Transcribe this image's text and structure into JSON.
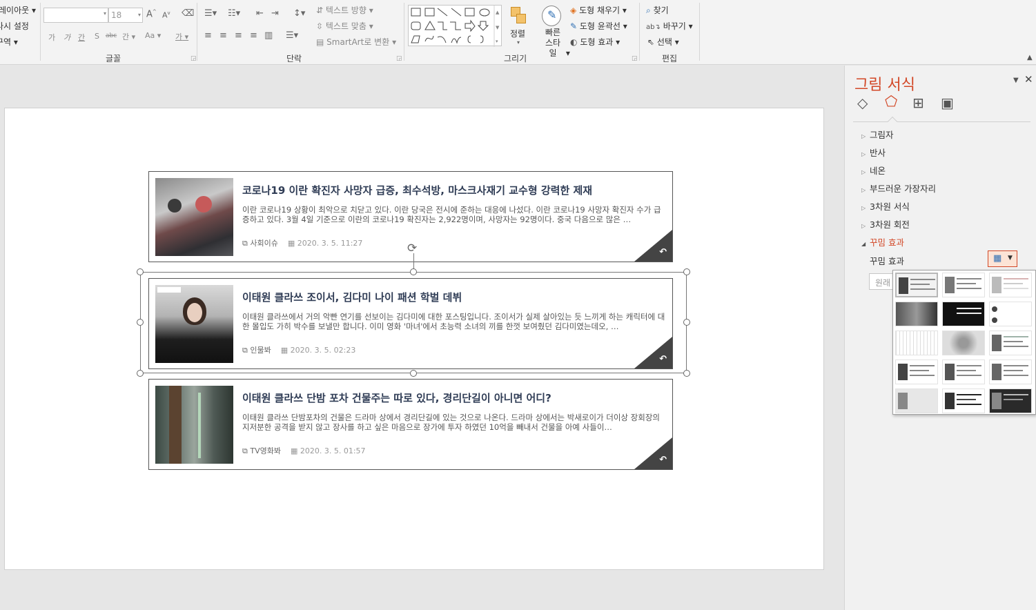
{
  "ribbon": {
    "layout_label": "레이아웃",
    "reset_label": "다시 설정",
    "section_label": "구역",
    "font_name": "",
    "font_size": "18",
    "font_group": "글꼴",
    "paragraph_group": "단락",
    "text_direction": "텍스트 방향",
    "text_align": "텍스트 맞춤",
    "smartart": "SmartArt로 변환",
    "drawing_group": "그리기",
    "arrange": "정렬",
    "quick_styles": "빠른 스타일",
    "shape_fill": "도형 채우기",
    "shape_outline": "도형 윤곽선",
    "shape_effects": "도형 효과",
    "find": "찾기",
    "replace": "바꾸기",
    "select": "선택",
    "editing_group": "편집",
    "font_glyphs": [
      "가",
      "가",
      "간",
      "S",
      "abc",
      "간",
      "Aa",
      "가"
    ]
  },
  "cards": [
    {
      "title": "코로나19 이란 확진자 사망자 급증, 최수석방, 마스크사재기 교수형 강력한 제재",
      "desc": "이란 코로나19 상황이 최악으로 치닫고 있다. 이란 당국은 전시에 준하는 대응에 나섰다. 이란 코로나19 사망자 확진자 수가 급증하고 있다. 3월 4일 기준으로 이란의 코로나19 확진자는 2,922명이며, 사망자는 92명이다. 중국 다음으로 많은 …",
      "category": "사회이슈",
      "date": "2020. 3. 5. 11:27"
    },
    {
      "title": "이태원 클라쓰 조이서, 김다미 나이 패션 학벌 데뷔",
      "desc": "이태원 클라쓰에서 거의 악빤 연기를 선보이는 김다미에 대한 포스팅입니다. 조이서가 실제 살아있는 듯 느끼게 하는 캐릭터에 대한 몰입도 가히 박수를 보낼만 합니다. 이미 영화 '마녀'에서 초능력 소녀의 끼를 한껏 보여줬던 김다미였는데오, …",
      "category": "인물봐",
      "date": "2020. 3. 5. 02:23"
    },
    {
      "title": "이태원 클라쓰 단밤 포차 건물주는 따로 있다, 경리단길이 아니면 어디?",
      "desc": "이태원 클라쓰 단밤포차의 건물은 드라마 상에서 경리단길에 있는 것으로 나온다. 드라마 상에서는 박새로이가 더이상 장회장의 지저분한 공격을 받지 않고 장사를 하고 싶은 마음으로 장가에 투자 하였던 10억을 빼내서 건물을 아예 사들이…",
      "category": "TV영화봐",
      "date": "2020. 3. 5. 01:57"
    }
  ],
  "pane": {
    "title": "그림 서식",
    "sections": [
      "그림자",
      "반사",
      "네온",
      "부드러운 가장자리",
      "3차원 서식",
      "3차원 회전",
      "꾸밈 효과"
    ],
    "effect_label": "꾸밈 효과",
    "reset_partial": "원래"
  }
}
